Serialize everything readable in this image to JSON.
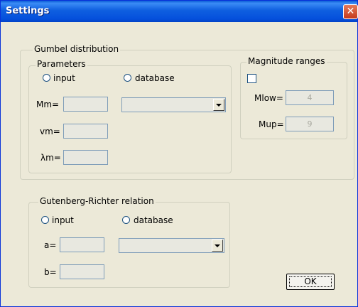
{
  "window": {
    "title": "Settings",
    "close_icon": "close-icon"
  },
  "gumbel": {
    "legend": "Gumbel distribution",
    "parameters": {
      "legend": "Parameters",
      "input_label": "input",
      "database_label": "database",
      "mm_label": "Mm=",
      "vm_label": "vm=",
      "lm_label": "λm=",
      "mm_value": "",
      "vm_value": "",
      "lm_value": "",
      "database_selected": ""
    },
    "ranges": {
      "legend": "Magnitude ranges",
      "mlow_label": "Mlow=",
      "mup_label": "Mup=",
      "mlow_value": "4",
      "mup_value": "9",
      "checked": false
    }
  },
  "gr": {
    "legend": "Gutenberg-Richter relation",
    "input_label": "input",
    "database_label": "database",
    "a_label": "a=",
    "b_label": "b=",
    "a_value": "",
    "b_value": "",
    "database_selected": ""
  },
  "ok_label": "OK"
}
